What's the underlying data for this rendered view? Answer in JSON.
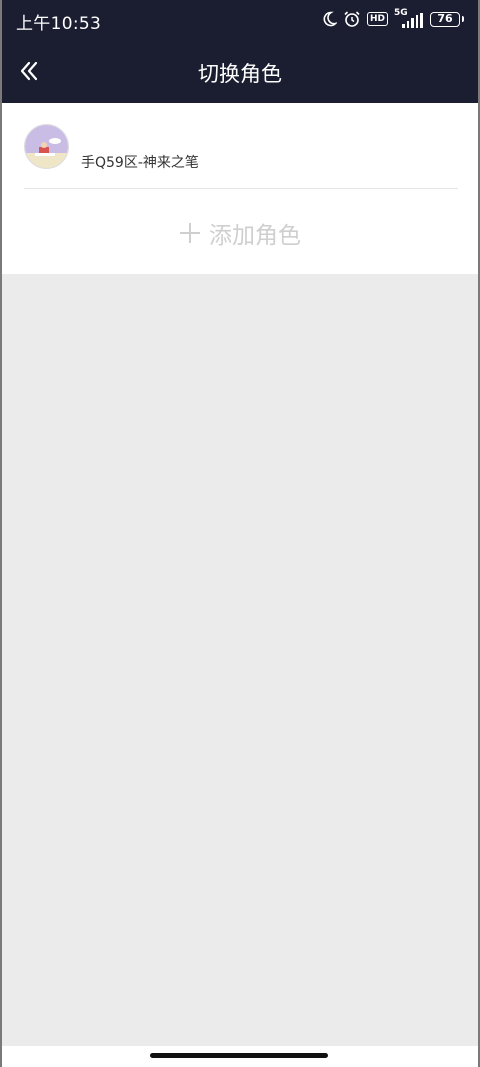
{
  "status_bar": {
    "time": "上午10:53",
    "network": "5G",
    "hd_badge": "HD",
    "battery": "76",
    "icons": [
      "moon-icon",
      "alarm-icon",
      "hd-icon",
      "signal-icon",
      "battery-icon"
    ]
  },
  "nav": {
    "title": "切换角色",
    "back_icon": "chevron-double-left-icon"
  },
  "roles": [
    {
      "name": "手Q59区-神来之笔",
      "avatar_icon": "role-avatar"
    }
  ],
  "actions": {
    "add_icon": "plus-icon",
    "add_label": "添加角色"
  },
  "colors": {
    "header_bg": "#1b1d30",
    "page_bg": "#ebebeb",
    "card_bg": "#ffffff",
    "add_text": "#cfcfcf"
  }
}
